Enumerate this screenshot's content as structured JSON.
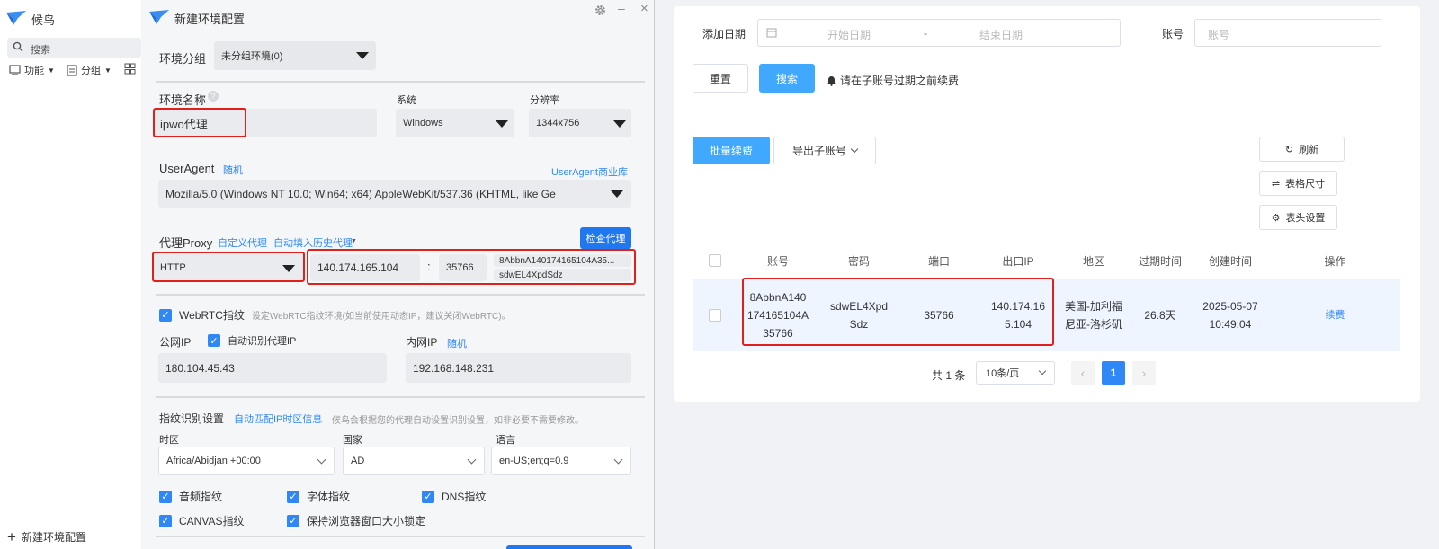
{
  "sidebar": {
    "app_name": "候鸟",
    "search_placeholder": "搜索",
    "function_label": "功能",
    "group_label": "分组",
    "new_env_label": "新建环境配置"
  },
  "dialog": {
    "title": "新建环境配置",
    "env_group_label": "环境分组",
    "env_group_value": "未分组环境(0)",
    "env_name_label": "环境名称",
    "env_name_value": "ipwo代理",
    "system_label": "系统",
    "system_value": "Windows",
    "resolution_label": "分辨率",
    "resolution_value": "1344x756",
    "useragent_label": "UserAgent",
    "useragent_random": "随机",
    "useragent_store": "UserAgent商业库",
    "useragent_value": "Mozilla/5.0 (Windows NT 10.0; Win64; x64) AppleWebKit/537.36 (KHTML, like Ge",
    "proxy_label": "代理Proxy",
    "proxy_custom": "自定义代理",
    "proxy_history": "自动填入历史代理",
    "check_proxy": "检查代理",
    "proxy_type": "HTTP",
    "proxy_ip": "140.174.165.104",
    "proxy_colon": ":",
    "proxy_port": "35766",
    "proxy_user": "8AbbnA140174165104A35...",
    "proxy_pass": "sdwEL4XpdSdz",
    "webrtc_label": "WebRTC指纹",
    "webrtc_hint": "设定WebRTC指纹环境(如当前使用动态IP，建议关闭WebRTC)。",
    "public_ip_label": "公网IP",
    "auto_ip_label": "自动识别代理IP",
    "public_ip_value": "180.104.45.43",
    "lan_ip_label": "内网IP",
    "lan_ip_random": "随机",
    "lan_ip_value": "192.168.148.231",
    "fingerprint_label": "指纹识别设置",
    "fingerprint_link": "自动匹配IP时区信息",
    "fingerprint_hint": "候鸟会根据您的代理自动设置识别设置，如非必要不需要修改。",
    "timezone_label": "时区",
    "timezone_value": "Africa/Abidjan +00:00",
    "country_label": "国家",
    "country_value": "AD",
    "language_label": "语言",
    "language_value": "en-US;en;q=0.9",
    "checks": [
      "音频指纹",
      "字体指纹",
      "DNS指纹",
      "CANVAS指纹",
      "保持浏览器窗口大小锁定"
    ]
  },
  "panel": {
    "add_date_label": "添加日期",
    "start_date_placeholder": "开始日期",
    "date_sep": "-",
    "end_date_placeholder": "结束日期",
    "account_label": "账号",
    "account_placeholder": "账号",
    "reset_button": "重置",
    "search_button": "搜索",
    "renew_hint": "请在子账号过期之前续费",
    "batch_renew": "批量续费",
    "export_sub": "导出子账号",
    "refresh": "刷新",
    "table_size": "表格尺寸",
    "header_settings": "表头设置",
    "columns": [
      "账号",
      "密码",
      "端口",
      "出口IP",
      "地区",
      "过期时间",
      "创建时间",
      "操作"
    ],
    "rows": [
      {
        "account_lines": [
          "8AbbnA140",
          "174165104A",
          "35766"
        ],
        "password_lines": [
          "sdwEL4Xpd",
          "Sdz"
        ],
        "port": "35766",
        "ip_lines": [
          "140.174.16",
          "5.104"
        ],
        "region_lines": [
          "美国-加利福",
          "尼亚-洛杉矶"
        ],
        "expire": "26.8天",
        "created_lines": [
          "2025-05-07",
          "10:49:04"
        ],
        "action": "续费"
      }
    ],
    "total": "共 1 条",
    "page_size": "10条/页",
    "current_page": "1"
  },
  "colors": {
    "accent": "#2f88f5",
    "highlight": "#e0201b",
    "button_blue": "#40a9ff"
  }
}
